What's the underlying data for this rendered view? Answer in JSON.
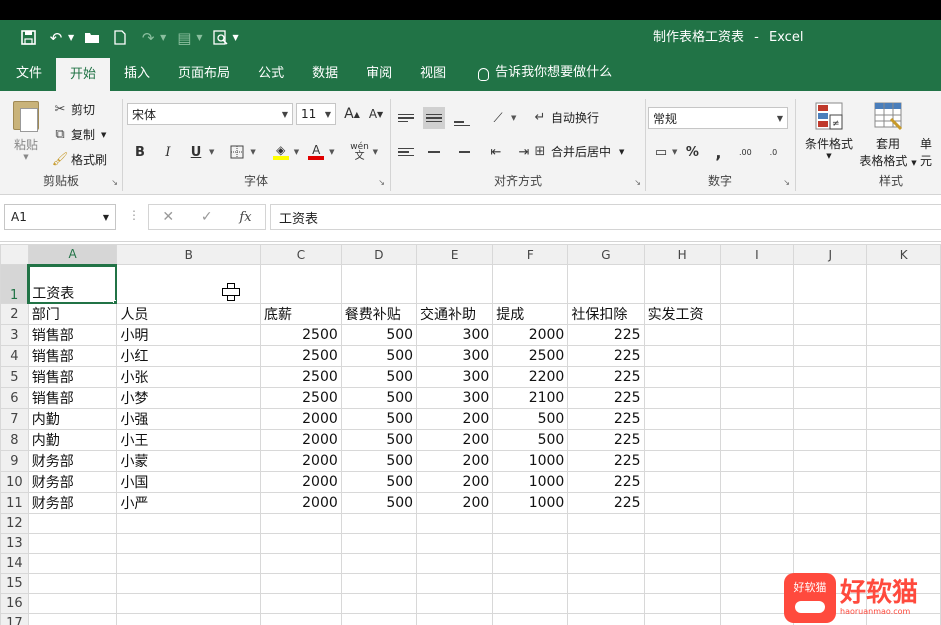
{
  "app": {
    "document_title": "制作表格工资表",
    "app_name": "Excel",
    "title_separator": "-"
  },
  "tabs": [
    "文件",
    "开始",
    "插入",
    "页面布局",
    "公式",
    "数据",
    "审阅",
    "视图"
  ],
  "tell_me": "告诉我你想要做什么",
  "ribbon": {
    "clipboard": {
      "paste": "粘贴",
      "cut": "剪切",
      "copy": "复制",
      "format_painter": "格式刷",
      "label": "剪贴板"
    },
    "font": {
      "font_name": "宋体",
      "font_size": "11",
      "bold": "B",
      "italic": "I",
      "underline": "U",
      "grow": "A",
      "shrink": "A",
      "font_color_letter": "A",
      "phonetic": "wén",
      "label": "字体"
    },
    "alignment": {
      "wrap_text": "自动换行",
      "merge_center": "合并后居中",
      "label": "对齐方式"
    },
    "number": {
      "format": "常规",
      "percent": "%",
      "comma": ",",
      "inc_decimal": ".00",
      "dec_decimal": ".0",
      "label": "数字"
    },
    "styles": {
      "conditional": "条件格式",
      "table_format_1": "套用",
      "table_format_2": "表格格式",
      "cell_styles": "单元",
      "label": "样式"
    }
  },
  "formula_bar": {
    "name_box": "A1",
    "fx": "fx",
    "content": "工资表"
  },
  "columns": [
    "A",
    "B",
    "C",
    "D",
    "E",
    "F",
    "G",
    "H",
    "I",
    "J",
    "K"
  ],
  "rows": [
    [
      "工资表",
      "",
      "",
      "",
      "",
      "",
      "",
      "",
      "",
      "",
      ""
    ],
    [
      "部门",
      "人员",
      "底薪",
      "餐费补贴",
      "交通补助",
      "提成",
      "社保扣除",
      "实发工资",
      "",
      "",
      ""
    ],
    [
      "销售部",
      "小明",
      "2500",
      "500",
      "300",
      "2000",
      "225",
      "",
      "",
      "",
      ""
    ],
    [
      "销售部",
      "小红",
      "2500",
      "500",
      "300",
      "2500",
      "225",
      "",
      "",
      "",
      ""
    ],
    [
      "销售部",
      "小张",
      "2500",
      "500",
      "300",
      "2200",
      "225",
      "",
      "",
      "",
      ""
    ],
    [
      "销售部",
      "小梦",
      "2500",
      "500",
      "300",
      "2100",
      "225",
      "",
      "",
      "",
      ""
    ],
    [
      "内勤",
      "小强",
      "2000",
      "500",
      "200",
      "500",
      "225",
      "",
      "",
      "",
      ""
    ],
    [
      "内勤",
      "小王",
      "2000",
      "500",
      "200",
      "500",
      "225",
      "",
      "",
      "",
      ""
    ],
    [
      "财务部",
      "小蒙",
      "2000",
      "500",
      "200",
      "1000",
      "225",
      "",
      "",
      "",
      ""
    ],
    [
      "财务部",
      "小国",
      "2000",
      "500",
      "200",
      "1000",
      "225",
      "",
      "",
      "",
      ""
    ],
    [
      "财务部",
      "小严",
      "2000",
      "500",
      "200",
      "1000",
      "225",
      "",
      "",
      "",
      ""
    ],
    [
      "",
      "",
      "",
      "",
      "",
      "",
      "",
      "",
      "",
      "",
      ""
    ],
    [
      "",
      "",
      "",
      "",
      "",
      "",
      "",
      "",
      "",
      "",
      ""
    ],
    [
      "",
      "",
      "",
      "",
      "",
      "",
      "",
      "",
      "",
      "",
      ""
    ],
    [
      "",
      "",
      "",
      "",
      "",
      "",
      "",
      "",
      "",
      "",
      ""
    ],
    [
      "",
      "",
      "",
      "",
      "",
      "",
      "",
      "",
      "",
      "",
      ""
    ],
    [
      "",
      "",
      "",
      "",
      "",
      "",
      "",
      "",
      "",
      "",
      ""
    ]
  ],
  "active_cell": "A1",
  "watermark": {
    "logo_text": "好软猫",
    "big_text": "好软猫",
    "url": "haoruanmao.com"
  },
  "colors": {
    "excel_green": "#217346",
    "watermark_red": "#ff4a3d"
  }
}
